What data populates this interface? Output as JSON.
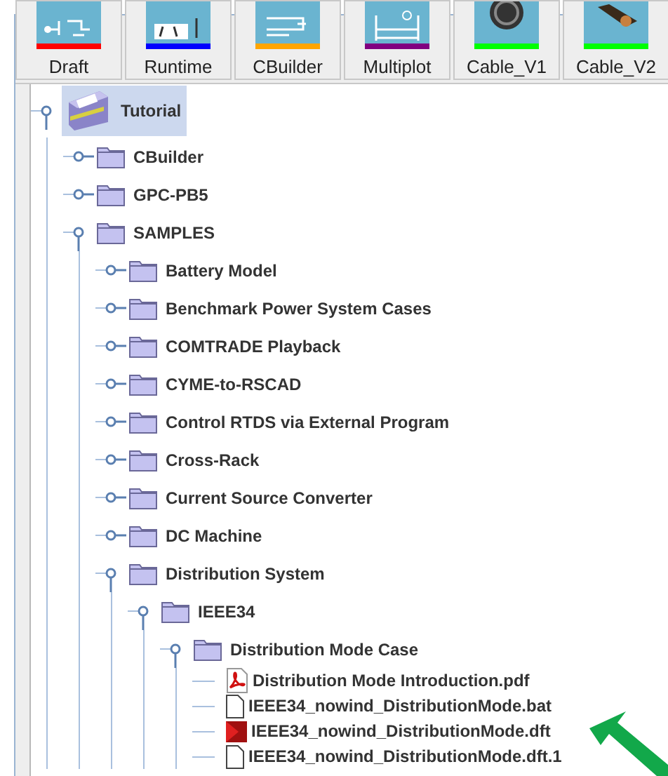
{
  "toolbar": [
    {
      "label": "Draft",
      "color": "#ff0000"
    },
    {
      "label": "Runtime",
      "color": "#0000ff"
    },
    {
      "label": "CBuilder",
      "color": "#ffa500"
    },
    {
      "label": "Multiplot",
      "color": "#800080"
    },
    {
      "label": "Cable_V1",
      "color": "#00ff00"
    },
    {
      "label": "Cable_V2",
      "color": "#00ff00"
    }
  ],
  "tree": [
    {
      "label": "Tutorial",
      "kind": "root",
      "expanded": true,
      "selected": true,
      "children": [
        {
          "label": "CBuilder",
          "kind": "folder",
          "expanded": false,
          "selected": false
        },
        {
          "label": "GPC-PB5",
          "kind": "folder",
          "expanded": false,
          "selected": false
        },
        {
          "label": "SAMPLES",
          "kind": "folder",
          "expanded": true,
          "selected": false,
          "children": [
            {
              "label": "Battery Model",
              "kind": "folder",
              "expanded": false,
              "selected": false
            },
            {
              "label": "Benchmark Power System Cases",
              "kind": "folder",
              "expanded": false,
              "selected": false
            },
            {
              "label": "COMTRADE Playback",
              "kind": "folder",
              "expanded": false,
              "selected": false
            },
            {
              "label": "CYME-to-RSCAD",
              "kind": "folder",
              "expanded": false,
              "selected": false
            },
            {
              "label": "Control RTDS via External Program",
              "kind": "folder",
              "expanded": false,
              "selected": false
            },
            {
              "label": "Cross-Rack",
              "kind": "folder",
              "expanded": false,
              "selected": false
            },
            {
              "label": "Current Source Converter",
              "kind": "folder",
              "expanded": false,
              "selected": false
            },
            {
              "label": "DC Machine",
              "kind": "folder",
              "expanded": false,
              "selected": false
            },
            {
              "label": "Distribution System",
              "kind": "folder",
              "expanded": true,
              "selected": false,
              "children": [
                {
                  "label": "IEEE34",
                  "kind": "folder",
                  "expanded": true,
                  "selected": false,
                  "children": [
                    {
                      "label": "Distribution Mode Case",
                      "kind": "folder",
                      "expanded": true,
                      "selected": false,
                      "children": [
                        {
                          "label": "Distribution Mode Introduction.pdf",
                          "kind": "pdf",
                          "selected": false
                        },
                        {
                          "label": "IEEE34_nowind_DistributionMode.bat",
                          "kind": "file",
                          "selected": false
                        },
                        {
                          "label": "IEEE34_nowind_DistributionMode.dft",
                          "kind": "draft",
                          "selected": false
                        },
                        {
                          "label": "IEEE34_nowind_DistributionMode.dft.1",
                          "kind": "file",
                          "selected": false
                        }
                      ]
                    }
                  ]
                }
              ]
            }
          ]
        }
      ]
    }
  ]
}
